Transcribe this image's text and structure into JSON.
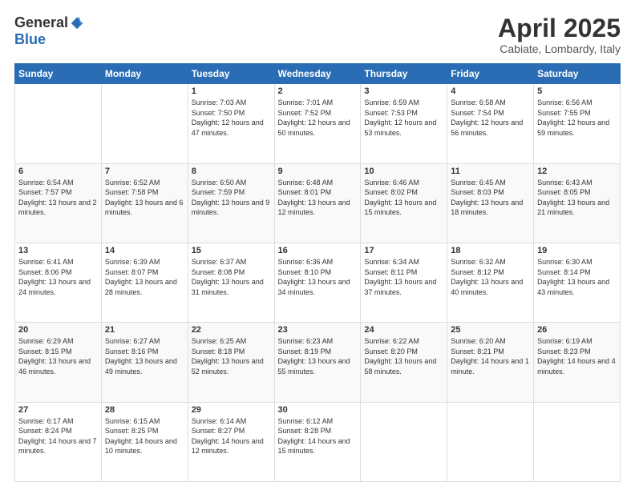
{
  "header": {
    "logo_general": "General",
    "logo_blue": "Blue",
    "title": "April 2025",
    "location": "Cabiate, Lombardy, Italy"
  },
  "weekdays": [
    "Sunday",
    "Monday",
    "Tuesday",
    "Wednesday",
    "Thursday",
    "Friday",
    "Saturday"
  ],
  "weeks": [
    [
      {
        "day": "",
        "info": ""
      },
      {
        "day": "",
        "info": ""
      },
      {
        "day": "1",
        "info": "Sunrise: 7:03 AM\nSunset: 7:50 PM\nDaylight: 12 hours and 47 minutes."
      },
      {
        "day": "2",
        "info": "Sunrise: 7:01 AM\nSunset: 7:52 PM\nDaylight: 12 hours and 50 minutes."
      },
      {
        "day": "3",
        "info": "Sunrise: 6:59 AM\nSunset: 7:53 PM\nDaylight: 12 hours and 53 minutes."
      },
      {
        "day": "4",
        "info": "Sunrise: 6:58 AM\nSunset: 7:54 PM\nDaylight: 12 hours and 56 minutes."
      },
      {
        "day": "5",
        "info": "Sunrise: 6:56 AM\nSunset: 7:55 PM\nDaylight: 12 hours and 59 minutes."
      }
    ],
    [
      {
        "day": "6",
        "info": "Sunrise: 6:54 AM\nSunset: 7:57 PM\nDaylight: 13 hours and 2 minutes."
      },
      {
        "day": "7",
        "info": "Sunrise: 6:52 AM\nSunset: 7:58 PM\nDaylight: 13 hours and 6 minutes."
      },
      {
        "day": "8",
        "info": "Sunrise: 6:50 AM\nSunset: 7:59 PM\nDaylight: 13 hours and 9 minutes."
      },
      {
        "day": "9",
        "info": "Sunrise: 6:48 AM\nSunset: 8:01 PM\nDaylight: 13 hours and 12 minutes."
      },
      {
        "day": "10",
        "info": "Sunrise: 6:46 AM\nSunset: 8:02 PM\nDaylight: 13 hours and 15 minutes."
      },
      {
        "day": "11",
        "info": "Sunrise: 6:45 AM\nSunset: 8:03 PM\nDaylight: 13 hours and 18 minutes."
      },
      {
        "day": "12",
        "info": "Sunrise: 6:43 AM\nSunset: 8:05 PM\nDaylight: 13 hours and 21 minutes."
      }
    ],
    [
      {
        "day": "13",
        "info": "Sunrise: 6:41 AM\nSunset: 8:06 PM\nDaylight: 13 hours and 24 minutes."
      },
      {
        "day": "14",
        "info": "Sunrise: 6:39 AM\nSunset: 8:07 PM\nDaylight: 13 hours and 28 minutes."
      },
      {
        "day": "15",
        "info": "Sunrise: 6:37 AM\nSunset: 8:08 PM\nDaylight: 13 hours and 31 minutes."
      },
      {
        "day": "16",
        "info": "Sunrise: 6:36 AM\nSunset: 8:10 PM\nDaylight: 13 hours and 34 minutes."
      },
      {
        "day": "17",
        "info": "Sunrise: 6:34 AM\nSunset: 8:11 PM\nDaylight: 13 hours and 37 minutes."
      },
      {
        "day": "18",
        "info": "Sunrise: 6:32 AM\nSunset: 8:12 PM\nDaylight: 13 hours and 40 minutes."
      },
      {
        "day": "19",
        "info": "Sunrise: 6:30 AM\nSunset: 8:14 PM\nDaylight: 13 hours and 43 minutes."
      }
    ],
    [
      {
        "day": "20",
        "info": "Sunrise: 6:29 AM\nSunset: 8:15 PM\nDaylight: 13 hours and 46 minutes."
      },
      {
        "day": "21",
        "info": "Sunrise: 6:27 AM\nSunset: 8:16 PM\nDaylight: 13 hours and 49 minutes."
      },
      {
        "day": "22",
        "info": "Sunrise: 6:25 AM\nSunset: 8:18 PM\nDaylight: 13 hours and 52 minutes."
      },
      {
        "day": "23",
        "info": "Sunrise: 6:23 AM\nSunset: 8:19 PM\nDaylight: 13 hours and 55 minutes."
      },
      {
        "day": "24",
        "info": "Sunrise: 6:22 AM\nSunset: 8:20 PM\nDaylight: 13 hours and 58 minutes."
      },
      {
        "day": "25",
        "info": "Sunrise: 6:20 AM\nSunset: 8:21 PM\nDaylight: 14 hours and 1 minute."
      },
      {
        "day": "26",
        "info": "Sunrise: 6:19 AM\nSunset: 8:23 PM\nDaylight: 14 hours and 4 minutes."
      }
    ],
    [
      {
        "day": "27",
        "info": "Sunrise: 6:17 AM\nSunset: 8:24 PM\nDaylight: 14 hours and 7 minutes."
      },
      {
        "day": "28",
        "info": "Sunrise: 6:15 AM\nSunset: 8:25 PM\nDaylight: 14 hours and 10 minutes."
      },
      {
        "day": "29",
        "info": "Sunrise: 6:14 AM\nSunset: 8:27 PM\nDaylight: 14 hours and 12 minutes."
      },
      {
        "day": "30",
        "info": "Sunrise: 6:12 AM\nSunset: 8:28 PM\nDaylight: 14 hours and 15 minutes."
      },
      {
        "day": "",
        "info": ""
      },
      {
        "day": "",
        "info": ""
      },
      {
        "day": "",
        "info": ""
      }
    ]
  ]
}
